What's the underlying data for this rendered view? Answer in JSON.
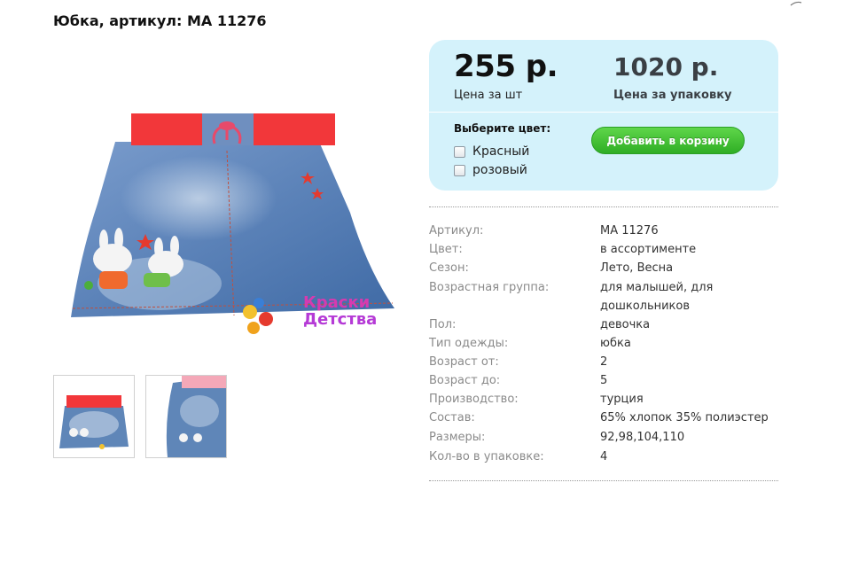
{
  "product": {
    "title": "Юбка, артикул: МА 11276"
  },
  "pricing": {
    "unit_price": "255 р.",
    "unit_label": "Цена за шт",
    "pack_price": "1020 р.",
    "pack_label": "Цена за упаковку"
  },
  "color_select": {
    "heading": "Выберите цвет:",
    "options": [
      {
        "label": "Красный",
        "checked": false
      },
      {
        "label": "розовый",
        "checked": false
      }
    ]
  },
  "cart": {
    "button_label": "Добавить в корзину"
  },
  "brand_watermark": {
    "text_line1": "Краски",
    "text_line2": "Детства"
  },
  "specs": [
    {
      "label": "Артикул:",
      "value": "МА 11276"
    },
    {
      "label": "Цвет:",
      "value": "в ассортименте"
    },
    {
      "label": "Сезон:",
      "value": "Лето, Весна"
    },
    {
      "label": "Возрастная группа:",
      "value": "для малышей, для дошкольников"
    },
    {
      "label": "Пол:",
      "value": "девочка"
    },
    {
      "label": "Тип одежды:",
      "value": "юбка"
    },
    {
      "label": "Возраст от:",
      "value": "2"
    },
    {
      "label": "Возраст до:",
      "value": "5"
    },
    {
      "label": "Производство:",
      "value": "турция"
    },
    {
      "label": "Состав:",
      "value": "65% хлопок 35% полиэстер"
    },
    {
      "label": "Размеры:",
      "value": "92,98,104,110"
    },
    {
      "label": "Кол-во в упаковке:",
      "value": "4"
    }
  ],
  "colors": {
    "panel_bg": "#d4f2fb",
    "button_green": "#3cc22f",
    "denim": "#5f86b8",
    "waistband": "#f2373a"
  }
}
